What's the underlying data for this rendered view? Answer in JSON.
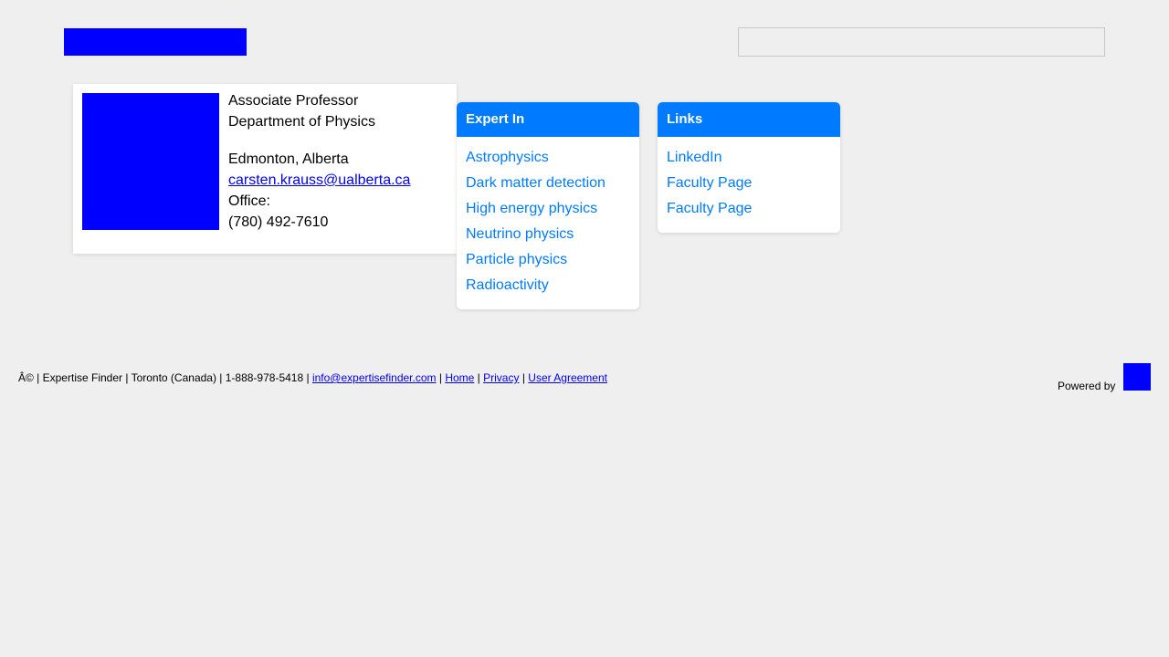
{
  "header": {
    "search": {
      "value": "",
      "placeholder": ""
    }
  },
  "profile": {
    "title": "Associate Professor",
    "department": "Department of Physics",
    "location": "Edmonton, Alberta",
    "email": "carsten.krauss@ualberta.ca",
    "office_label": "Office:",
    "phone": "(780) 492-7610"
  },
  "expertise": {
    "heading": "Expert In",
    "items": [
      "Astrophysics",
      "Dark matter detection",
      "High energy physics",
      "Neutrino physics",
      "Particle physics",
      "Radioactivity"
    ]
  },
  "links": {
    "heading": "Links",
    "items": [
      "LinkedIn",
      "Faculty Page",
      "Faculty Page"
    ]
  },
  "footer": {
    "copyright": "Â© | Expertise Finder | Toronto (Canada) | 1-888-978-5418 | ",
    "email": "info@expertisefinder.com",
    "sep": " | ",
    "home": "Home",
    "privacy": "Privacy",
    "agreement": "User Agreement",
    "powered_by": "Powered by"
  },
  "colors": {
    "background": "#efefef",
    "accent": "#007bff",
    "placeholder_image": "#0000ff",
    "link": "#0000ee"
  }
}
